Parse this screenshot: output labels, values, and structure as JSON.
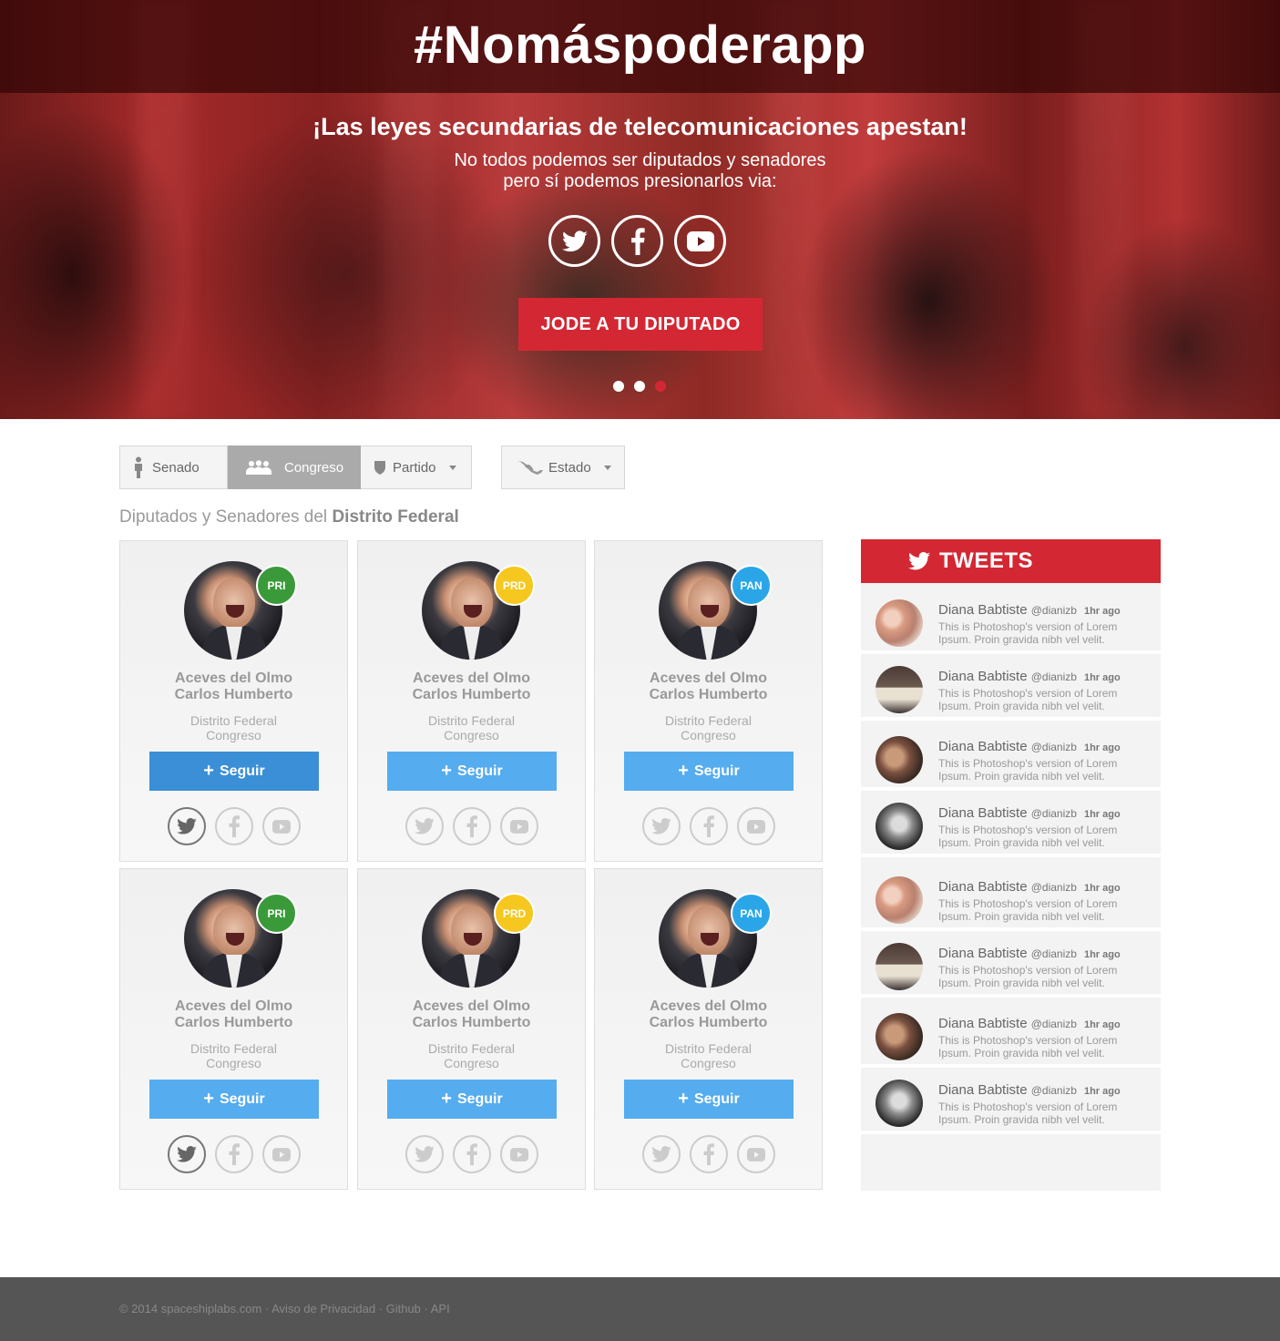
{
  "hero": {
    "brand": "#Nomáspoderapp",
    "headline": "¡Las leyes secundarias de telecomunicaciones apestan!",
    "sub_line1": "No todos podemos ser diputados y senadores",
    "sub_line2": "pero sí podemos presionarlos via:",
    "social_icons": [
      "twitter-icon",
      "facebook-icon",
      "youtube-icon"
    ],
    "cta_label": "JODE A TU DIPUTADO",
    "slides": 3,
    "active_slide": 3
  },
  "filters": {
    "senado": "Senado",
    "congreso": "Congreso",
    "partido": "Partido",
    "estado": "Estado",
    "active": "congreso"
  },
  "section": {
    "prefix": "Diputados y Senadores del",
    "region": "Distrito Federal"
  },
  "cards": [
    {
      "party": "PRI",
      "color": "#3a9a3a",
      "name1": "Aceves del Olmo",
      "name2": "Carlos Humberto",
      "region": "Distrito Federal",
      "chamber": "Congreso",
      "follow": "Seguir"
    },
    {
      "party": "PRD",
      "color": "#f5c71f",
      "name1": "Aceves del Olmo",
      "name2": "Carlos Humberto",
      "region": "Distrito Federal",
      "chamber": "Congreso",
      "follow": "Seguir"
    },
    {
      "party": "PAN",
      "color": "#2aa6e8",
      "name1": "Aceves del Olmo",
      "name2": "Carlos Humberto",
      "region": "Distrito Federal",
      "chamber": "Congreso",
      "follow": "Seguir"
    },
    {
      "party": "PRI",
      "color": "#3a9a3a",
      "name1": "Aceves del Olmo",
      "name2": "Carlos Humberto",
      "region": "Distrito Federal",
      "chamber": "Congreso",
      "follow": "Seguir"
    },
    {
      "party": "PRD",
      "color": "#f5c71f",
      "name1": "Aceves del Olmo",
      "name2": "Carlos Humberto",
      "region": "Distrito Federal",
      "chamber": "Congreso",
      "follow": "Seguir"
    },
    {
      "party": "PAN",
      "color": "#2aa6e8",
      "name1": "Aceves del Olmo",
      "name2": "Carlos Humberto",
      "region": "Distrito Federal",
      "chamber": "Congreso",
      "follow": "Seguir"
    }
  ],
  "tweets": {
    "title": "TWEETS",
    "items": [
      {
        "name": "Diana Babtiste",
        "handle": "@dianizb",
        "time": "1hr ago",
        "text": "This is Photoshop's version  of Lorem Ipsum. Proin gravida nibh vel velit."
      },
      {
        "name": "Diana Babtiste",
        "handle": "@dianizb",
        "time": "1hr ago",
        "text": "This is Photoshop's version  of Lorem Ipsum. Proin gravida nibh vel velit."
      },
      {
        "name": "Diana Babtiste",
        "handle": "@dianizb",
        "time": "1hr ago",
        "text": "This is Photoshop's version  of Lorem Ipsum. Proin gravida nibh vel velit."
      },
      {
        "name": "Diana Babtiste",
        "handle": "@dianizb",
        "time": "1hr ago",
        "text": "This is Photoshop's version  of Lorem Ipsum. Proin gravida nibh vel velit."
      },
      {
        "name": "Diana Babtiste",
        "handle": "@dianizb",
        "time": "1hr ago",
        "text": "This is Photoshop's version  of Lorem Ipsum. Proin gravida nibh vel velit."
      },
      {
        "name": "Diana Babtiste",
        "handle": "@dianizb",
        "time": "1hr ago",
        "text": "This is Photoshop's version  of Lorem Ipsum. Proin gravida nibh vel velit."
      },
      {
        "name": "Diana Babtiste",
        "handle": "@dianizb",
        "time": "1hr ago",
        "text": "This is Photoshop's version  of Lorem Ipsum. Proin gravida nibh vel velit."
      },
      {
        "name": "Diana Babtiste",
        "handle": "@dianizb",
        "time": "1hr ago",
        "text": "This is Photoshop's version  of Lorem Ipsum. Proin gravida nibh vel velit."
      }
    ]
  },
  "footer": {
    "text": "© 2014 spaceshiplabs.com · Aviso de Privacidad · Github  ·  API"
  },
  "colors": {
    "accent_red": "#d32833",
    "follow_blue": "#55acee",
    "footer_bg": "#555555"
  }
}
